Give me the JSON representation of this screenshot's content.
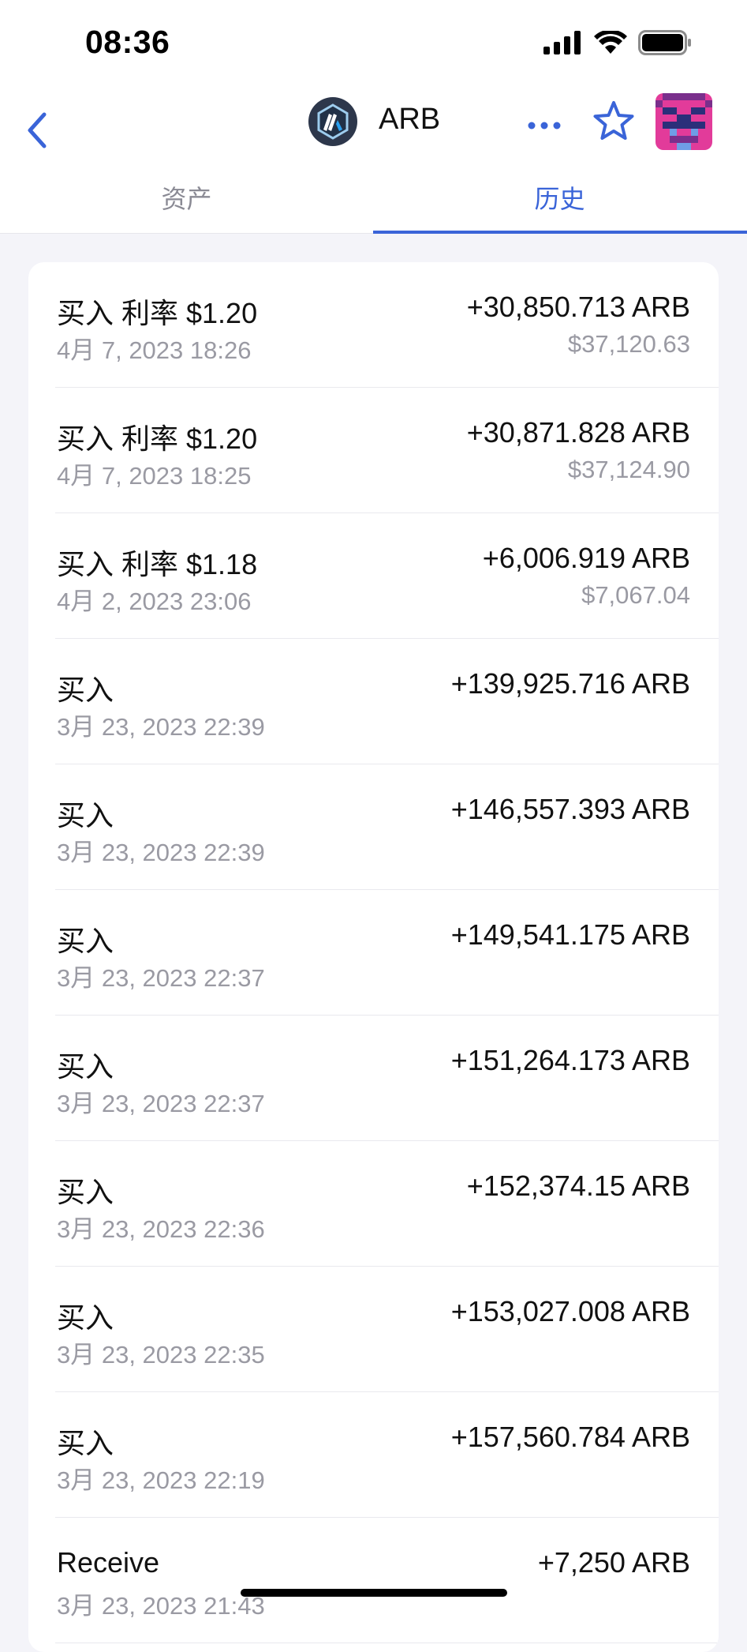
{
  "status_bar": {
    "time": "08:36"
  },
  "header": {
    "title": "ARB",
    "back_icon": "chevron-left-icon",
    "more_icon": "ellipsis-icon",
    "star_icon": "star-outline-icon",
    "accent_color": "#3a64d8"
  },
  "tabs": [
    {
      "label": "资产",
      "active": false
    },
    {
      "label": "历史",
      "active": true
    }
  ],
  "transactions": [
    {
      "title": "买入 利率 $1.20",
      "date": "4月 7, 2023 18:26",
      "amount": "+30,850.713 ARB",
      "usd": "$37,120.63"
    },
    {
      "title": "买入 利率 $1.20",
      "date": "4月 7, 2023 18:25",
      "amount": "+30,871.828 ARB",
      "usd": "$37,124.90"
    },
    {
      "title": "买入 利率 $1.18",
      "date": "4月 2, 2023 23:06",
      "amount": "+6,006.919 ARB",
      "usd": "$7,067.04"
    },
    {
      "title": "买入",
      "date": "3月 23, 2023 22:39",
      "amount": "+139,925.716 ARB",
      "usd": ""
    },
    {
      "title": "买入",
      "date": "3月 23, 2023 22:39",
      "amount": "+146,557.393 ARB",
      "usd": ""
    },
    {
      "title": "买入",
      "date": "3月 23, 2023 22:37",
      "amount": "+149,541.175 ARB",
      "usd": ""
    },
    {
      "title": "买入",
      "date": "3月 23, 2023 22:37",
      "amount": "+151,264.173 ARB",
      "usd": ""
    },
    {
      "title": "买入",
      "date": "3月 23, 2023 22:36",
      "amount": "+152,374.15 ARB",
      "usd": ""
    },
    {
      "title": "买入",
      "date": "3月 23, 2023 22:35",
      "amount": "+153,027.008 ARB",
      "usd": ""
    },
    {
      "title": "买入",
      "date": "3月 23, 2023 22:19",
      "amount": "+157,560.784 ARB",
      "usd": ""
    },
    {
      "title": "Receive",
      "date": "3月 23, 2023 21:43",
      "amount": "+7,250 ARB",
      "usd": ""
    }
  ]
}
